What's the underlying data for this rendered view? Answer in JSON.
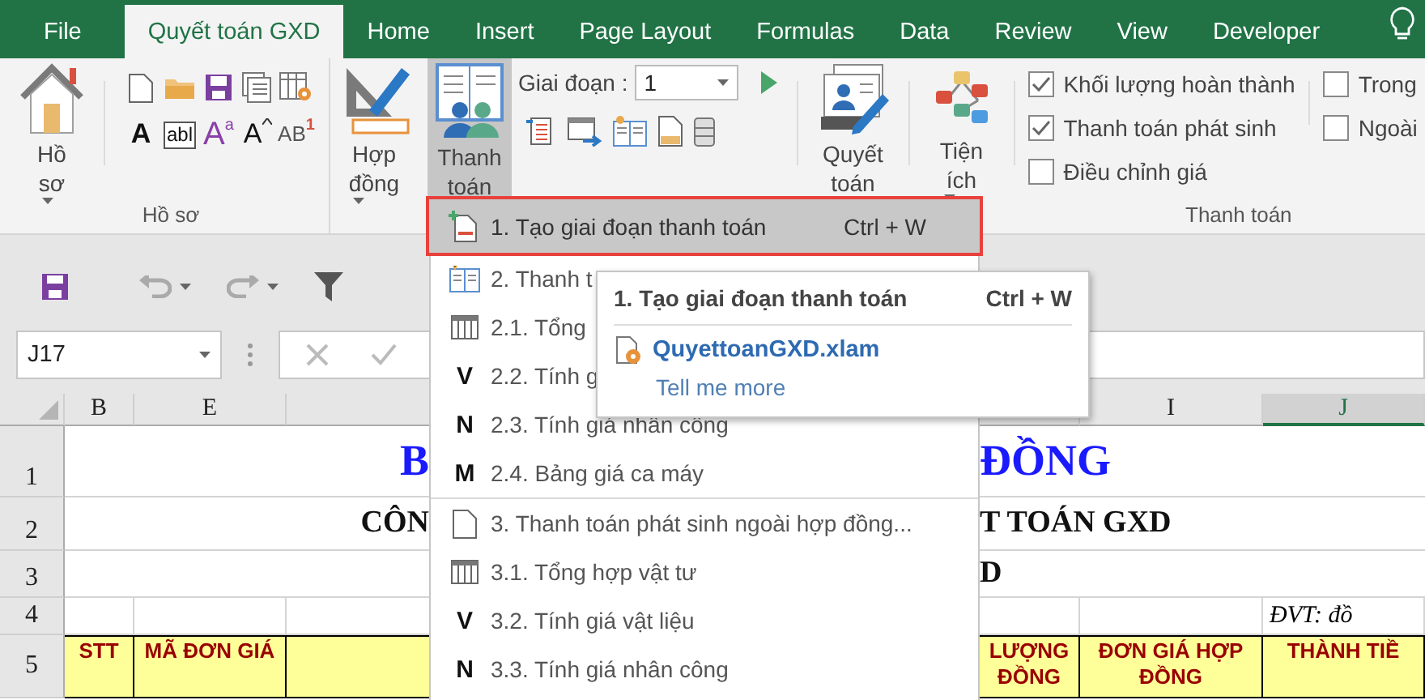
{
  "tabs": [
    {
      "label": "File",
      "selected": false
    },
    {
      "label": "Quyết toán GXD",
      "selected": true
    },
    {
      "label": "Home",
      "selected": false
    },
    {
      "label": "Insert",
      "selected": false
    },
    {
      "label": "Page Layout",
      "selected": false
    },
    {
      "label": "Formulas",
      "selected": false
    },
    {
      "label": "Data",
      "selected": false
    },
    {
      "label": "Review",
      "selected": false
    },
    {
      "label": "View",
      "selected": false
    },
    {
      "label": "Developer",
      "selected": false
    }
  ],
  "ribbon": {
    "ho_so_button": {
      "label": "Hồ sơ",
      "pressed": false
    },
    "small_icons": [
      {
        "kind": "page"
      },
      {
        "kind": "folder"
      },
      {
        "kind": "disk"
      },
      {
        "kind": "copies"
      },
      {
        "kind": "sheet-gear"
      },
      {
        "kind": "bold-letter",
        "glyph": "A"
      },
      {
        "kind": "text-box",
        "glyph": "abl"
      },
      {
        "kind": "superscript",
        "glyph": "A",
        "sup": "a"
      },
      {
        "kind": "grow-font",
        "glyph": "A"
      },
      {
        "kind": "numbering",
        "glyph": "AB",
        "sup": "1"
      }
    ],
    "ho_so_group_label": "Hồ sơ",
    "hop_dong_button": {
      "label": "Hợp đồng",
      "pressed": false
    },
    "thanh_toan_button": {
      "label": "Thanh toán",
      "pressed": true
    },
    "giai_doan": {
      "label": "Giai đoạn :",
      "value": "1"
    },
    "tool_icons": [
      {
        "kind": "list-arrow"
      },
      {
        "kind": "window-arrow"
      },
      {
        "kind": "book-star"
      },
      {
        "kind": "page-fill"
      },
      {
        "kind": "stack"
      }
    ],
    "quyet_toan_button": {
      "label": "Quyết toán",
      "pressed": false
    },
    "tien_ich_button": {
      "label": "Tiện ích",
      "pressed": false
    },
    "checkboxes": [
      {
        "label": "Khối lượng hoàn thành",
        "checked": true
      },
      {
        "label": "Thanh toán phát sinh",
        "checked": true
      },
      {
        "label": "Điều chỉnh giá",
        "checked": false
      }
    ],
    "checkboxes_2": [
      {
        "label": "Trong",
        "checked": false
      },
      {
        "label": "Ngoài",
        "checked": false
      }
    ],
    "thanh_toan_group_label": "Thanh toán"
  },
  "name_box": {
    "value": "J17"
  },
  "columns": [
    {
      "label": "B",
      "selected": false
    },
    {
      "label": "E",
      "selected": false
    },
    {
      "label": "I",
      "selected": false
    },
    {
      "label": "J",
      "selected": true
    }
  ],
  "rows": [
    {
      "number": "1",
      "kind": "title",
      "left": "B",
      "right": "ĐỒNG"
    },
    {
      "number": "2",
      "kind": "subtitle",
      "left": "CÔN",
      "right": "T TOÁN GXD"
    },
    {
      "number": "3",
      "kind": "subtitle",
      "right": "D"
    },
    {
      "number": "4",
      "kind": "unit",
      "note": "ĐVT: đồ"
    },
    {
      "number": "5",
      "kind": "header",
      "cells": [
        "STT",
        "MÃ ĐƠN GIÁ",
        "",
        "LƯỢNG ĐỒNG",
        "ĐƠN GIÁ HỢP ĐỒNG",
        "THÀNH TIỀ"
      ]
    }
  ],
  "menu": [
    {
      "label": "1. Tạo giai đoạn thanh toán",
      "shortcut": "Ctrl + W",
      "kind": "page-plus",
      "selected": true,
      "divider_above": false
    },
    {
      "label": "2. Thanh t",
      "kind": "book",
      "selected": false,
      "divider_above": false
    },
    {
      "label": "2.1. Tổng",
      "kind": "grid",
      "selected": false,
      "divider_above": false
    },
    {
      "label": "2.2. Tính g",
      "kind": "letter",
      "glyph": "V",
      "selected": false,
      "divider_above": false
    },
    {
      "label": "2.3. Tính giá nhân công",
      "kind": "letter",
      "glyph": "N",
      "selected": false,
      "divider_above": false
    },
    {
      "label": "2.4. Bảng giá ca máy",
      "kind": "letter",
      "glyph": "M",
      "selected": false,
      "divider_above": false
    },
    {
      "label": "3. Thanh toán phát sinh ngoài hợp đồng...",
      "kind": "page",
      "selected": false,
      "divider_above": true
    },
    {
      "label": "3.1. Tổng hợp vật tư",
      "kind": "grid",
      "selected": false,
      "divider_above": false
    },
    {
      "label": "3.2. Tính giá vật liệu",
      "kind": "letter",
      "glyph": "V",
      "selected": false,
      "divider_above": false
    },
    {
      "label": "3.3. Tính giá nhân công",
      "kind": "letter",
      "glyph": "N",
      "selected": false,
      "divider_above": false
    }
  ],
  "tooltip": {
    "title": "1. Tạo giai đoạn thanh toán",
    "shortcut": "Ctrl + W",
    "addin": "QuyettoanGXD.xlam",
    "link": "Tell me more"
  }
}
